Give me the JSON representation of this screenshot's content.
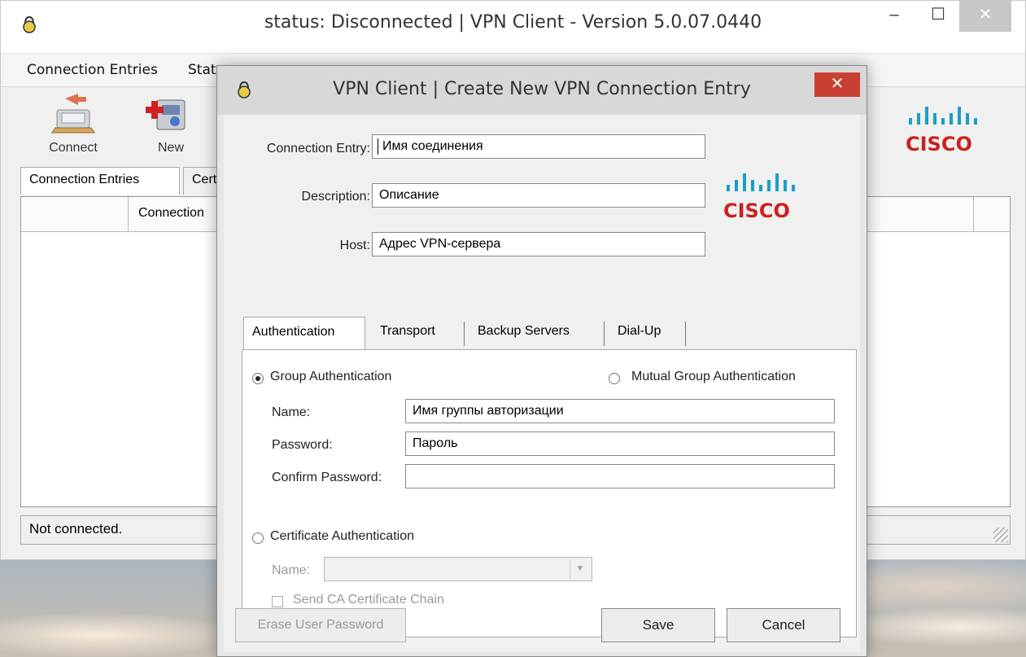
{
  "main_window": {
    "title": "status: Disconnected | VPN Client - Version 5.0.07.0440",
    "menu": [
      "Connection Entries",
      "Stat"
    ],
    "toolbar": {
      "connect_label": "Connect",
      "new_label": "New"
    },
    "brand": "CISCO",
    "tabs": [
      "Connection Entries",
      "Cert"
    ],
    "list_columns": [
      "Connection"
    ],
    "status_text": "Not connected."
  },
  "dialog": {
    "title": "VPN Client  |  Create New VPN Connection Entry",
    "brand": "CISCO",
    "connection_entry": {
      "label": "Connection Entry:",
      "value": "Имя соединения"
    },
    "description": {
      "label": "Description:",
      "value": "Описание"
    },
    "host": {
      "label": "Host:",
      "value": "Адрес VPN-сервера"
    },
    "tabs": [
      "Authentication",
      "Transport",
      "Backup Servers",
      "Dial-Up"
    ],
    "active_tab": "Authentication",
    "auth": {
      "group_auth_label": "Group Authentication",
      "group_auth_selected": true,
      "mutual_auth_label": "Mutual Group Authentication",
      "mutual_auth_selected": false,
      "name_label": "Name:",
      "name_value": "Имя группы авторизации",
      "password_label": "Password:",
      "password_value": "Пароль",
      "confirm_label": "Confirm Password:",
      "confirm_value": "",
      "cert_auth_label": "Certificate Authentication",
      "cert_auth_selected": false,
      "cert_name_label": "Name:",
      "cert_name_value": "",
      "send_ca_label": "Send CA Certificate Chain",
      "send_ca_checked": false
    },
    "buttons": {
      "erase": "Erase User Password",
      "save": "Save",
      "cancel": "Cancel"
    }
  },
  "colors": {
    "close_button": "#c84032",
    "cisco_red": "#cc2020",
    "cisco_blue": "#1aa0c8"
  }
}
